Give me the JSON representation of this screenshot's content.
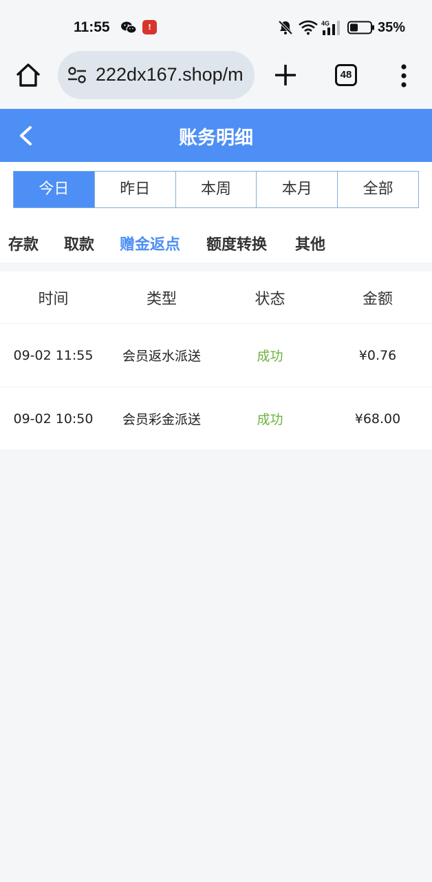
{
  "status_bar": {
    "time": "11:55",
    "notif_badge": "!",
    "battery": "35%"
  },
  "browser": {
    "url": "222dx167.shop/m",
    "tab_count": "48"
  },
  "header": {
    "title": "账务明细"
  },
  "date_tabs": [
    {
      "label": "今日",
      "active": true
    },
    {
      "label": "昨日",
      "active": false
    },
    {
      "label": "本周",
      "active": false
    },
    {
      "label": "本月",
      "active": false
    },
    {
      "label": "全部",
      "active": false
    }
  ],
  "category_tabs": [
    {
      "label": "存款",
      "active": false
    },
    {
      "label": "取款",
      "active": false
    },
    {
      "label": "赠金返点",
      "active": true
    },
    {
      "label": "额度转换",
      "active": false
    },
    {
      "label": "其他",
      "active": false
    }
  ],
  "table": {
    "headers": [
      "时间",
      "类型",
      "状态",
      "金额"
    ],
    "rows": [
      {
        "time": "09-02 11:55",
        "type": "会员返水派送",
        "status": "成功",
        "amount": "¥0.76"
      },
      {
        "time": "09-02 10:50",
        "type": "会员彩金派送",
        "status": "成功",
        "amount": "¥68.00"
      }
    ]
  },
  "colors": {
    "accent": "#4d8ff5",
    "success": "#6cb33e",
    "background": "#f4f6f8"
  }
}
